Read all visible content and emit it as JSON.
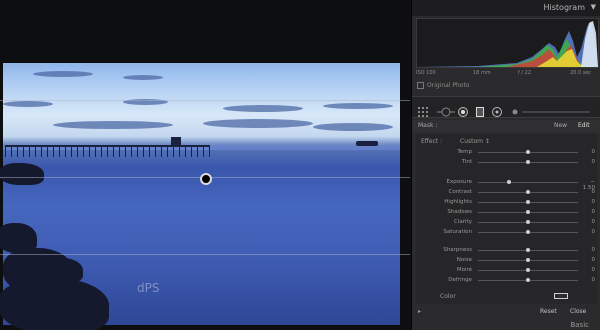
{
  "histogram": {
    "title": "Histogram",
    "iso": "ISO 100",
    "focal": "18 mm",
    "aperture": "f / 22",
    "shutter": "20.0 sec",
    "original_photo": "Original Photo"
  },
  "mask": {
    "label": "Mask :",
    "new": "New",
    "edit": "Edit"
  },
  "effect": {
    "label": "Effect :",
    "value": "Custom  ↕"
  },
  "sliders": [
    {
      "label": "Temp",
      "value": "0",
      "pos": 0.5
    },
    {
      "label": "Tint",
      "value": "0",
      "pos": 0.5
    },
    {
      "label": "Exposure",
      "value": "− 1.50",
      "pos": 0.31
    },
    {
      "label": "Contrast",
      "value": "0",
      "pos": 0.5
    },
    {
      "label": "Highlights",
      "value": "0",
      "pos": 0.5
    },
    {
      "label": "Shadows",
      "value": "0",
      "pos": 0.5
    },
    {
      "label": "Clarity",
      "value": "0",
      "pos": 0.5
    },
    {
      "label": "Saturation",
      "value": "0",
      "pos": 0.5
    },
    {
      "label": "Sharpness",
      "value": "0",
      "pos": 0.5
    },
    {
      "label": "Noise",
      "value": "0",
      "pos": 0.5
    },
    {
      "label": "Moiré",
      "value": "0",
      "pos": 0.5
    },
    {
      "label": "Defringe",
      "value": "0",
      "pos": 0.5
    }
  ],
  "color": {
    "label": "Color"
  },
  "buttons": {
    "reset": "Reset",
    "close": "Close"
  },
  "basic": "Basic",
  "watermark": "dPS",
  "colors": {
    "panel": "#2b2b2d",
    "accent": "#cfcfcf"
  }
}
